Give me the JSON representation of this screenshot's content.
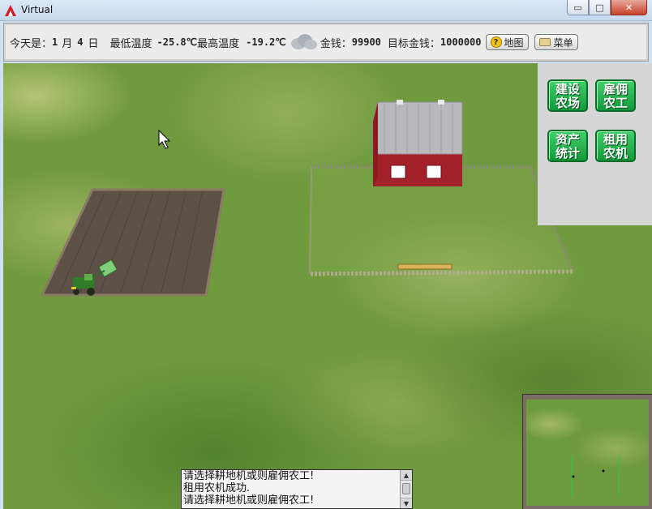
{
  "window": {
    "title": "Virtual",
    "minimize": "▭",
    "maximize": "□",
    "close": "✕"
  },
  "infobar": {
    "date_label": "今天是：",
    "month": "1",
    "month_unit": "月",
    "day": "4",
    "day_unit": "日",
    "min_temp_label": "最低温度",
    "min_temp": "-25.8℃",
    "max_temp_label": "最高温度",
    "max_temp": "-19.2℃",
    "weather_icon": "cloud-icon",
    "money_label": "金钱：",
    "money": "99900",
    "target_label": "目标金钱：",
    "target": "1000000",
    "map_button": "地图",
    "menu_button": "菜单"
  },
  "actions": [
    {
      "line1": "建设",
      "line2": "农场"
    },
    {
      "line1": "雇佣",
      "line2": "农工"
    },
    {
      "line1": "资产",
      "line2": "统计"
    },
    {
      "line1": "租用",
      "line2": "农机"
    }
  ],
  "messages": [
    "请选择耕地机或则雇佣农工!",
    "租用农机成功.",
    "请选择耕地机或则雇佣农工!"
  ],
  "colors": {
    "action_button": "#1cae45",
    "barn_roof": "#b9b9bd",
    "barn_wall": "#a3212a",
    "field_soil": "#5c5047",
    "tractor": "#2f7d2a"
  }
}
